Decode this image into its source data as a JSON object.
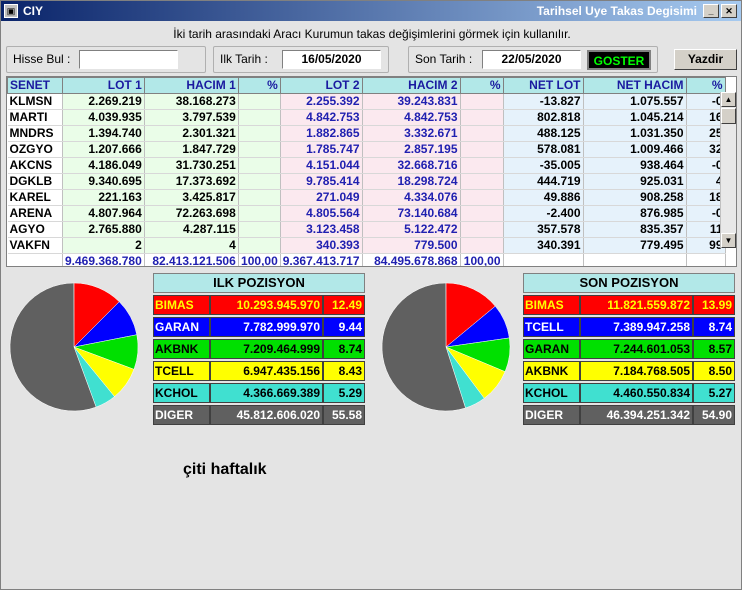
{
  "window": {
    "title_left": "CIY",
    "title_right": "Tarihsel Uye Takas Degisimi",
    "app_icon": "app-icon"
  },
  "info_text": "İki tarih arasındaki  Aracı Kurumun takas değişimlerini görmek için kullanılır.",
  "controls": {
    "hisse_label": "Hisse Bul :",
    "hisse_value": "",
    "ilk_label": "Ilk Tarih :",
    "ilk_value": "16/05/2020",
    "son_label": "Son Tarih :",
    "son_value": "22/05/2020",
    "goster": "GOSTER",
    "yazdir": "Yazdir"
  },
  "grid": {
    "headers": [
      "SENET",
      "LOT 1",
      "HACIM 1",
      "%",
      "LOT 2",
      "HACIM 2",
      "%",
      "NET LOT",
      "NET HACIM",
      "%"
    ],
    "rows": [
      [
        "KLMSN",
        "2.269.219",
        "38.168.273",
        "",
        "2.255.392",
        "39.243.831",
        "",
        "-13.827",
        "1.075.557",
        "-0"
      ],
      [
        "MARTI",
        "4.039.935",
        "3.797.539",
        "",
        "4.842.753",
        "4.842.753",
        "",
        "802.818",
        "1.045.214",
        "16"
      ],
      [
        "MNDRS",
        "1.394.740",
        "2.301.321",
        "",
        "1.882.865",
        "3.332.671",
        "",
        "488.125",
        "1.031.350",
        "25"
      ],
      [
        "OZGYO",
        "1.207.666",
        "1.847.729",
        "",
        "1.785.747",
        "2.857.195",
        "",
        "578.081",
        "1.009.466",
        "32"
      ],
      [
        "AKCNS",
        "4.186.049",
        "31.730.251",
        "",
        "4.151.044",
        "32.668.716",
        "",
        "-35.005",
        "938.464",
        "-0"
      ],
      [
        "DGKLB",
        "9.340.695",
        "17.373.692",
        "",
        "9.785.414",
        "18.298.724",
        "",
        "444.719",
        "925.031",
        "4"
      ],
      [
        "KAREL",
        "221.163",
        "3.425.817",
        "",
        "271.049",
        "4.334.076",
        "",
        "49.886",
        "908.258",
        "18"
      ],
      [
        "ARENA",
        "4.807.964",
        "72.263.698",
        "",
        "4.805.564",
        "73.140.684",
        "",
        "-2.400",
        "876.985",
        "-0"
      ],
      [
        "AGYO",
        "2.765.880",
        "4.287.115",
        "",
        "3.123.458",
        "5.122.472",
        "",
        "357.578",
        "835.357",
        "11"
      ],
      [
        "VAKFN",
        "2",
        "4",
        "",
        "340.393",
        "779.500",
        "",
        "340.391",
        "779.495",
        "99"
      ]
    ],
    "totals": [
      "",
      "9.469.368.780",
      "82.413.121.506",
      "100,00",
      "9.367.413.717",
      "84.495.678.868",
      "100,00",
      "",
      "",
      ""
    ]
  },
  "ilk": {
    "title": "ILK POZISYON",
    "rows": [
      {
        "name": "BIMAS",
        "value": "10.293.945.970",
        "pct": "12.49",
        "color": "#ff0000"
      },
      {
        "name": "GARAN",
        "value": "7.782.999.970",
        "pct": "9.44",
        "color": "#0000ff"
      },
      {
        "name": "AKBNK",
        "value": "7.209.464.999",
        "pct": "8.74",
        "color": "#00e000"
      },
      {
        "name": "TCELL",
        "value": "6.947.435.156",
        "pct": "8.43",
        "color": "#ffff00"
      },
      {
        "name": "KCHOL",
        "value": "4.366.669.389",
        "pct": "5.29",
        "color": "#40e0d0"
      },
      {
        "name": "DIGER",
        "value": "45.812.606.020",
        "pct": "55.58",
        "color": "#606060"
      }
    ]
  },
  "son": {
    "title": "SON POZISYON",
    "rows": [
      {
        "name": "BIMAS",
        "value": "11.821.559.872",
        "pct": "13.99",
        "color": "#ff0000"
      },
      {
        "name": "TCELL",
        "value": "7.389.947.258",
        "pct": "8.74",
        "color": "#0000ff"
      },
      {
        "name": "GARAN",
        "value": "7.244.601.053",
        "pct": "8.57",
        "color": "#00e000"
      },
      {
        "name": "AKBNK",
        "value": "7.184.768.505",
        "pct": "8.50",
        "color": "#ffff00"
      },
      {
        "name": "KCHOL",
        "value": "4.460.550.834",
        "pct": "5.27",
        "color": "#40e0d0"
      },
      {
        "name": "DIGER",
        "value": "46.394.251.342",
        "pct": "54.90",
        "color": "#606060"
      }
    ]
  },
  "caption": "çiti haftalık"
}
